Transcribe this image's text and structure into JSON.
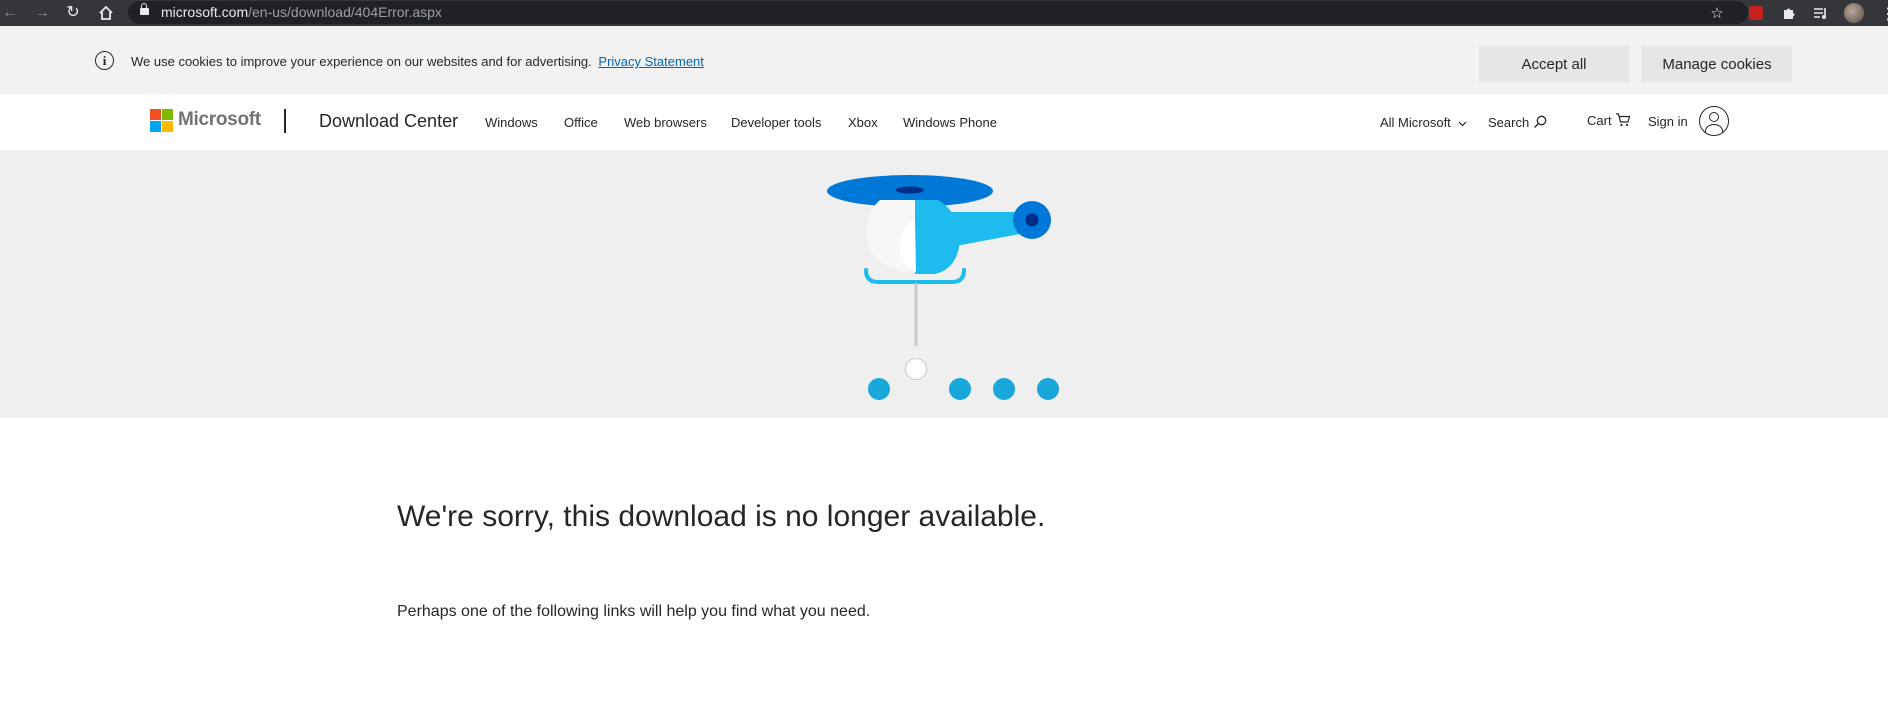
{
  "browser": {
    "url_host": "microsoft.com",
    "url_path": "/en-us/download/404Error.aspx",
    "icons": [
      "back-arrow-icon",
      "forward-arrow-icon",
      "reload-icon",
      "home-icon",
      "lock-icon",
      "star-icon",
      "extension-icon",
      "puzzle-icon",
      "reading-list-icon",
      "profile-avatar",
      "menu-icon"
    ]
  },
  "cookie_banner": {
    "message": "We use cookies to improve your experience on our websites and for advertising.",
    "privacy_link": "Privacy Statement",
    "accept_label": "Accept all",
    "manage_label": "Manage cookies"
  },
  "header": {
    "brand": "Microsoft",
    "section_title": "Download Center",
    "nav": [
      "Windows",
      "Office",
      "Web browsers",
      "Developer tools",
      "Xbox",
      "Windows Phone"
    ],
    "all_microsoft": "All Microsoft",
    "search": "Search",
    "cart": "Cart",
    "sign_in": "Sign in"
  },
  "colors": {
    "ms_red": "#f25022",
    "ms_green": "#7fba00",
    "ms_blue": "#00a4ef",
    "ms_yellow": "#ffb900",
    "link": "#0067b8",
    "heli_cyan": "#1ebbee",
    "heli_blue": "#0078d7",
    "heli_navy": "#002c8a"
  },
  "main": {
    "title": "We're sorry, this download is no longer available.",
    "subtitle": "Perhaps one of the following links will help you find what you need."
  }
}
